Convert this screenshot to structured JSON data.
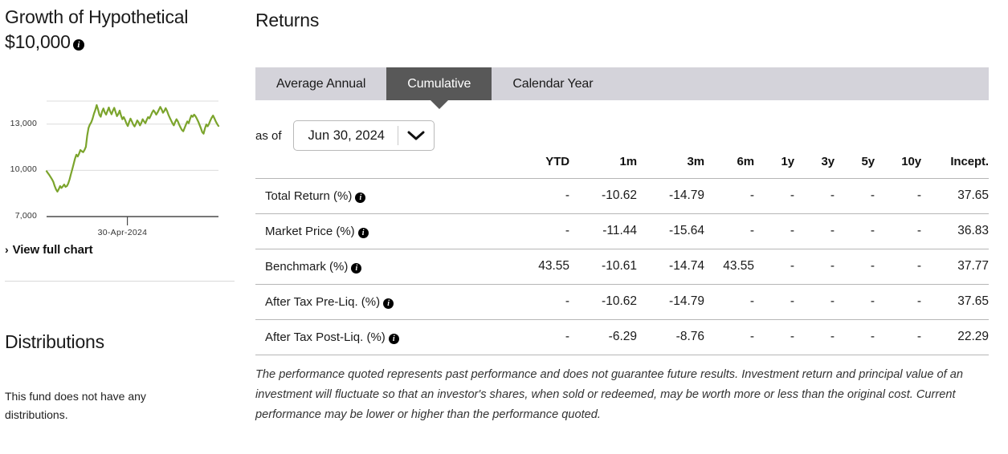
{
  "left": {
    "growth_title": "Growth of Hypothetical $10,000",
    "growth_info_icon": "info-icon",
    "view_full_chart": "View full chart",
    "view_full_chevron": "›",
    "distributions_title": "Distributions",
    "distributions_body": "This fund does not have any distributions."
  },
  "right": {
    "section_title": "Returns",
    "tabs": [
      {
        "label": "Average Annual",
        "active": false
      },
      {
        "label": "Cumulative",
        "active": true
      },
      {
        "label": "Calendar Year",
        "active": false
      }
    ],
    "asof_label": "as of",
    "asof_value": "Jun 30, 2024",
    "asof_icon": "chevron-down-icon",
    "columns": [
      "",
      "YTD",
      "1m",
      "3m",
      "6m",
      "1y",
      "3y",
      "5y",
      "10y",
      "Incept."
    ],
    "rows": [
      {
        "label": "Total Return (%)",
        "values": [
          "-",
          "-10.62",
          "-14.79",
          "-",
          "-",
          "-",
          "-",
          "-",
          "37.65"
        ]
      },
      {
        "label": "Market Price (%)",
        "values": [
          "-",
          "-11.44",
          "-15.64",
          "-",
          "-",
          "-",
          "-",
          "-",
          "36.83"
        ]
      },
      {
        "label": "Benchmark (%)",
        "values": [
          "43.55",
          "-10.61",
          "-14.74",
          "43.55",
          "-",
          "-",
          "-",
          "-",
          "37.77"
        ]
      },
      {
        "label": "After Tax Pre-Liq. (%)",
        "values": [
          "-",
          "-10.62",
          "-14.79",
          "-",
          "-",
          "-",
          "-",
          "-",
          "37.65"
        ]
      },
      {
        "label": "After Tax Post-Liq. (%)",
        "values": [
          "-",
          "-6.29",
          "-8.76",
          "-",
          "-",
          "-",
          "-",
          "-",
          "22.29"
        ]
      }
    ],
    "disclaimer": "The performance quoted represents past performance and does not guarantee future results. Investment return and principal value of an investment will fluctuate so that an investor's shares, when sold or redeemed, may be worth more or less than the original cost. Current performance may be lower or higher than the performance quoted."
  },
  "colors": {
    "line": "#7BA42C",
    "tabbar": "#D4D3DA",
    "tab_active": "#585858",
    "grid": "#DCDCDC",
    "axis": "#4A4A4A"
  },
  "chart_data": {
    "type": "line",
    "title": "Growth of Hypothetical $10,000",
    "xlabel": "",
    "ylabel": "",
    "ylim": [
      7000,
      14500
    ],
    "yticks": [
      7000,
      10000,
      13000
    ],
    "ytick_labels": [
      "7,000",
      "10,000",
      "13,000"
    ],
    "xticks": [
      "30-Apr-2024"
    ],
    "grid": true,
    "legend": "none",
    "series": [
      {
        "name": "Hypothetical Growth",
        "color": "#7BA42C",
        "values": [
          9950,
          9820,
          9700,
          9560,
          9420,
          9250,
          8980,
          8760,
          8620,
          8780,
          8980,
          8860,
          8960,
          9080,
          8930,
          8980,
          9150,
          9420,
          9760,
          10080,
          10420,
          10760,
          11020,
          10900,
          11080,
          11320,
          11240,
          11180,
          11320,
          11520,
          12250,
          12760,
          12980,
          13120,
          13360,
          13680,
          13920,
          14240,
          13960,
          13620,
          13480,
          13820,
          14020,
          13760,
          13620,
          13860,
          14080,
          13820,
          13640,
          13880,
          14060,
          13780,
          13520,
          13660,
          13880,
          13560,
          13320,
          13460,
          13280,
          13050,
          12880,
          13140,
          13360,
          13180,
          12980,
          12850,
          13020,
          13240,
          13120,
          12920,
          13080,
          13320,
          13180,
          13060,
          13280,
          13460,
          13380,
          13560,
          13760,
          13900,
          13780,
          13620,
          13760,
          13940,
          14120,
          13960,
          13740,
          13860,
          14040,
          13860,
          13620,
          13420,
          13240,
          13060,
          12920,
          13140,
          13320,
          13180,
          12960,
          12780,
          12620,
          12540,
          12760,
          12980,
          13180,
          13060,
          13340,
          13560,
          13480,
          13620,
          13520,
          13360,
          13180,
          12960,
          12740,
          12480,
          12380,
          12720,
          12980,
          12860,
          13020,
          13240,
          13420,
          13560,
          13380,
          13180,
          13020,
          12880
        ]
      }
    ]
  }
}
